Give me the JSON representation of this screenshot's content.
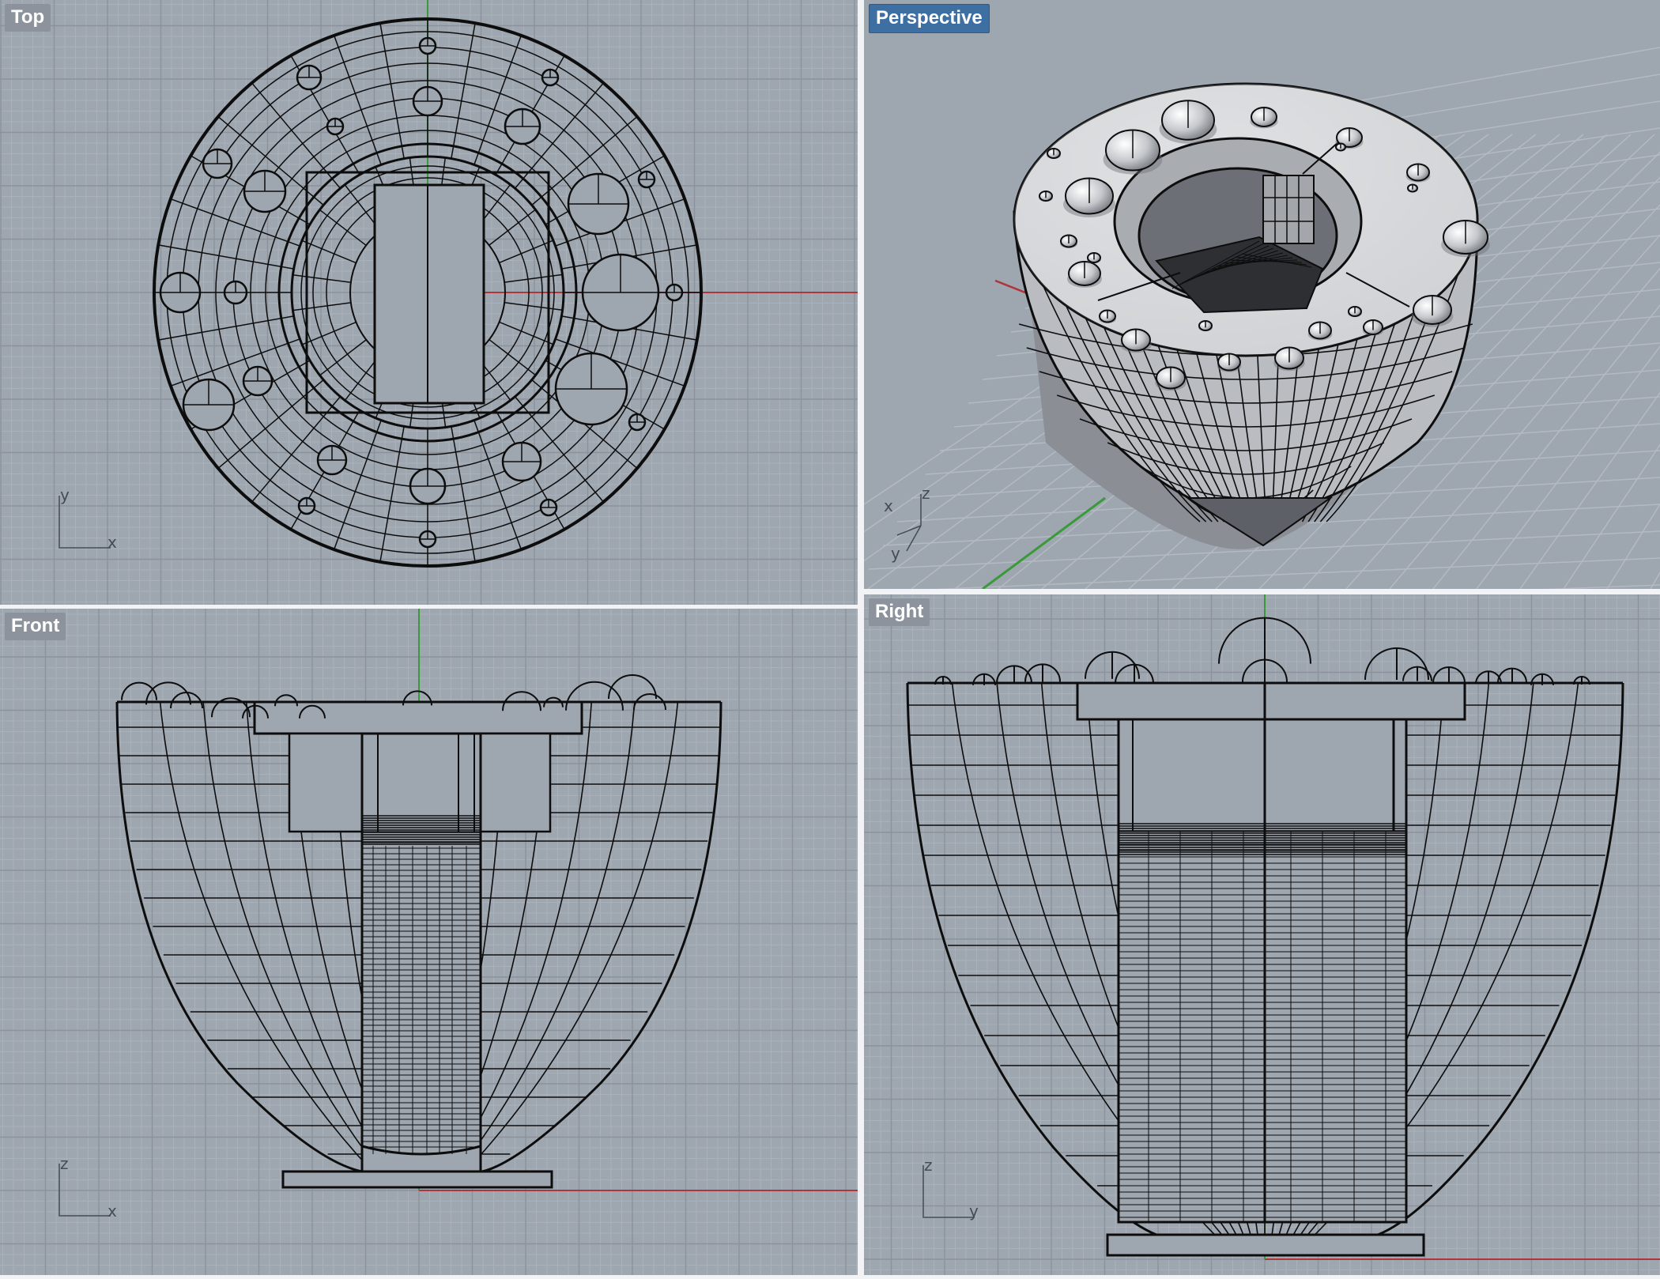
{
  "viewports": {
    "top": {
      "label": "Top",
      "axes": {
        "vertical": "y",
        "horizontal": "x"
      }
    },
    "perspective": {
      "label": "Perspective",
      "axes": {
        "first": "x",
        "second": "z",
        "third": "y"
      }
    },
    "front": {
      "label": "Front",
      "axes": {
        "vertical": "z",
        "horizontal": "x"
      }
    },
    "right": {
      "label": "Right",
      "axes": {
        "vertical": "z",
        "horizontal": "y"
      }
    }
  },
  "active_viewport": "perspective",
  "colors": {
    "viewport_background": "#9ea6b0",
    "grid_minor": "#aab1ba",
    "grid_major": "#8b929b",
    "x_axis": "#b0353a",
    "y_axis": "#3a9a3a",
    "wireframe": "#0d0d0d",
    "active_tab": "#3d6fa3",
    "inactive_tab": "#8c939c"
  }
}
